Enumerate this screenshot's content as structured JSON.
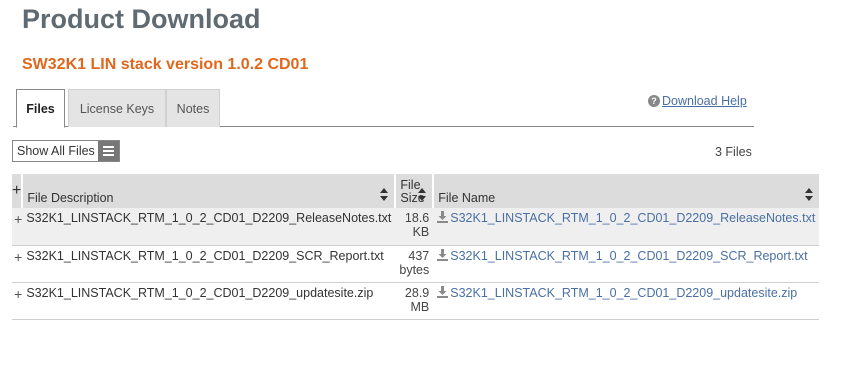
{
  "page": {
    "title": "Product Download",
    "subtitle": "SW32K1 LIN stack version 1.0.2 CD01"
  },
  "tabs": [
    {
      "label": "Files",
      "active": true
    },
    {
      "label": "License Keys",
      "active": false
    },
    {
      "label": "Notes",
      "active": false
    }
  ],
  "help": {
    "icon": "question-circle-icon",
    "label": "Download Help"
  },
  "toolbar": {
    "show_all_label": "Show All Files",
    "file_count": "3 Files"
  },
  "table": {
    "headers": {
      "expand": "+",
      "description": "File Description",
      "size_line1": "File",
      "size_line2": "Size",
      "name": "File Name"
    },
    "rows": [
      {
        "expand": "+",
        "description": "S32K1_LINSTACK_RTM_1_0_2_CD01_D2209_ReleaseNotes.txt",
        "size_value": "18.6",
        "size_unit": "KB",
        "file_name": "S32K1_LINSTACK_RTM_1_0_2_CD01_D2209_ReleaseNotes.txt"
      },
      {
        "expand": "+",
        "description": "S32K1_LINSTACK_RTM_1_0_2_CD01_D2209_SCR_Report.txt",
        "size_value": "437",
        "size_unit": "bytes",
        "file_name": "S32K1_LINSTACK_RTM_1_0_2_CD01_D2209_SCR_Report.txt"
      },
      {
        "expand": "+",
        "description": "S32K1_LINSTACK_RTM_1_0_2_CD01_D2209_updatesite.zip",
        "size_value": "28.9",
        "size_unit": "MB",
        "file_name": "S32K1_LINSTACK_RTM_1_0_2_CD01_D2209_updatesite.zip"
      }
    ]
  },
  "colors": {
    "title": "#5f6a72",
    "subtitle": "#e0681e",
    "link": "#4a6fa5",
    "header_bg": "#dcdcdc"
  }
}
